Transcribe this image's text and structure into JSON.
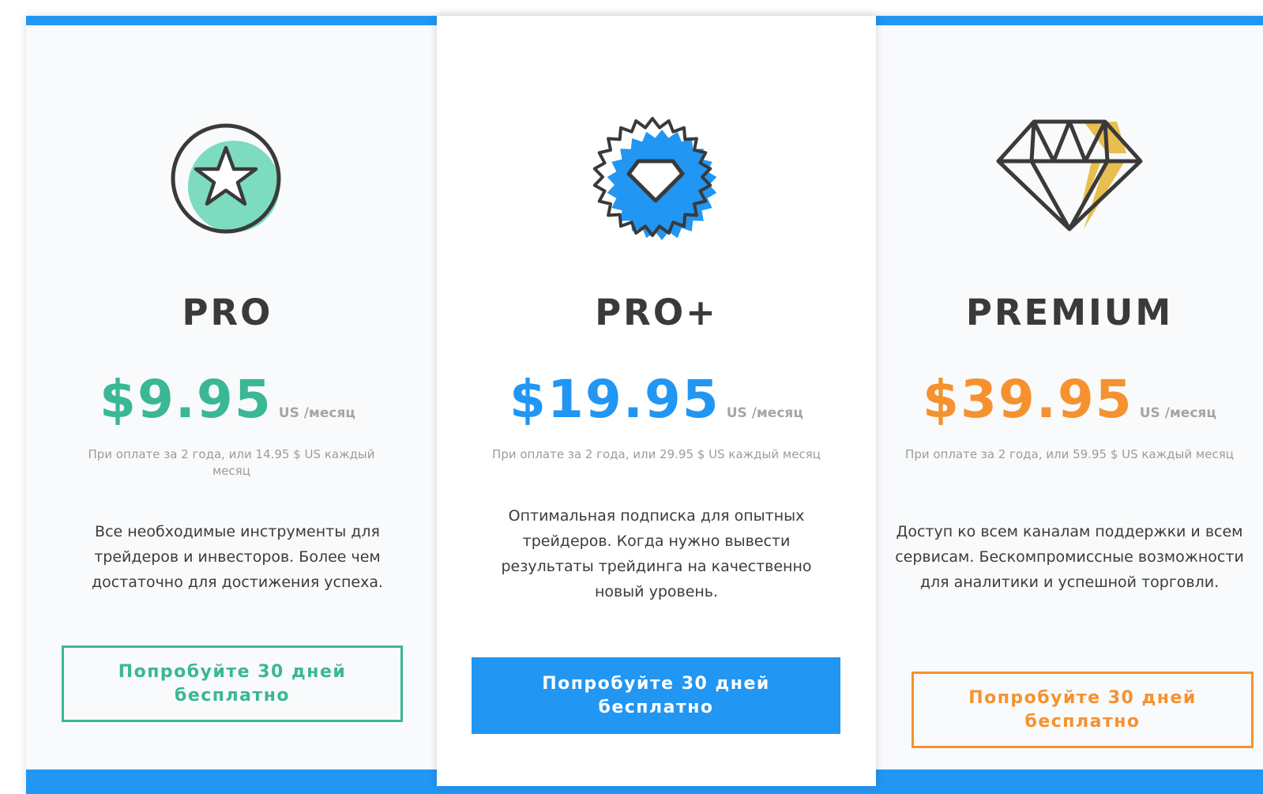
{
  "colors": {
    "accent_blue": "#2196f3",
    "pro_green": "#3ab795",
    "premium_orange": "#f5922f",
    "gold": "#e8be50",
    "icon_dark": "#3a3a3a"
  },
  "plans": [
    {
      "name": "PRO",
      "price": "$9.95",
      "unit": "US /месяц",
      "billing": "При оплате за 2 года, или 14.95 $ US каждый месяц",
      "description": "Все необходимые инструменты для трейдеров и инвесторов. Более чем достаточно для достижения успеха.",
      "cta_line1": "Попробуйте 30 дней",
      "cta_line2": "бесплатно",
      "icon": "star-badge-icon",
      "color": "#3ab795"
    },
    {
      "name": "PRO+",
      "price": "$19.95",
      "unit": "US /месяц",
      "billing": "При оплате за 2 года, или 29.95 $ US каждый месяц",
      "description": "Оптимальная подписка для опытных трейдеров. Когда нужно вывести результаты трейдинга на качественно новый уровень.",
      "cta_line1": "Попробуйте 30 дней",
      "cta_line2": "бесплатно",
      "icon": "diamond-seal-icon",
      "color": "#2196f3"
    },
    {
      "name": "PREMIUM",
      "price": "$39.95",
      "unit": "US /месяц",
      "billing": "При оплате за 2 года, или 59.95 $ US каждый месяц",
      "description": "Доступ ко всем каналам поддержки и всем сервисам. Бескомпромиссные возможности для аналитики и успешной торговли.",
      "cta_line1": "Попробуйте 30 дней",
      "cta_line2": "бесплатно",
      "icon": "diamond-icon",
      "color": "#f5922f"
    }
  ]
}
